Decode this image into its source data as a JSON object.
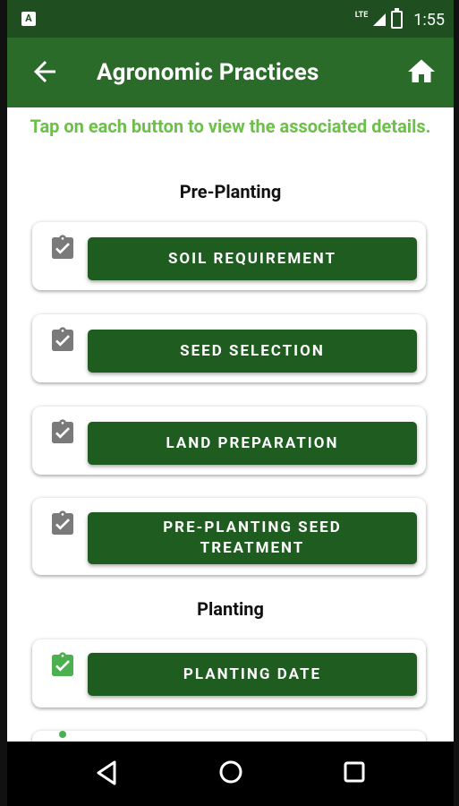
{
  "status_bar": {
    "notification_icon": "A",
    "network": "LTE",
    "time": "1:55"
  },
  "app_bar": {
    "title": "Agronomic Practices",
    "back_icon": "arrow-left",
    "home_icon": "home"
  },
  "instruction": "Tap on each button to view the associated details.",
  "sections": [
    {
      "title": "Pre-Planting"
    },
    {
      "title": "Planting"
    }
  ],
  "items": [
    {
      "label": "SOIL REQUIREMENT",
      "checked": false
    },
    {
      "label": "SEED SELECTION",
      "checked": false
    },
    {
      "label": "LAND PREPARATION",
      "checked": false
    },
    {
      "label": "PRE-PLANTING SEED TREATMENT",
      "checked": false
    },
    {
      "label": "PLANTING DATE",
      "checked": true
    }
  ],
  "colors": {
    "app_bar": "#2a6b2a",
    "button": "#1f5c20",
    "instruction_text": "#6cc04a",
    "checked_icon": "#4caf50",
    "unchecked_icon": "#7a7a7a"
  }
}
